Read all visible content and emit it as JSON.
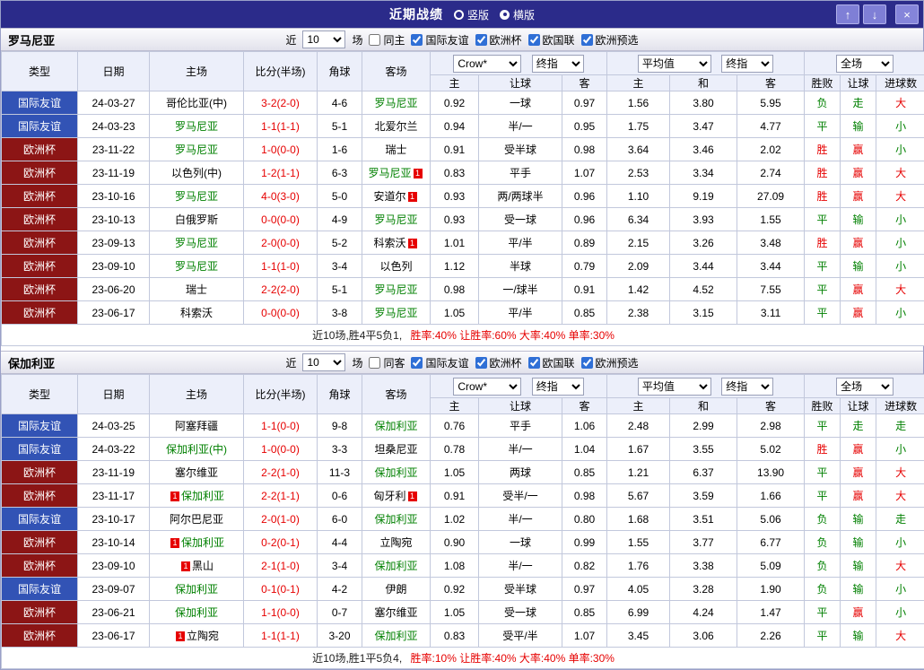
{
  "titlebar": {
    "title": "近期战绩",
    "radios": [
      {
        "label": "竖版",
        "selected": false
      },
      {
        "label": "横版",
        "selected": true
      }
    ],
    "buttons": {
      "up": "↑",
      "down": "↓",
      "close": "×"
    }
  },
  "columns": {
    "type": "类型",
    "date": "日期",
    "home": "主场",
    "score": "比分(半场)",
    "corner": "角球",
    "away": "客场",
    "ah": [
      "主",
      "让球",
      "客"
    ],
    "eu": [
      "主",
      "和",
      "客"
    ],
    "res": [
      "胜败",
      "让球",
      "进球数"
    ]
  },
  "selects": {
    "ah_source": "Crow*",
    "ah_time": "终指",
    "eu_source": "平均值",
    "eu_time": "终指",
    "scope": "全场"
  },
  "league_colors": {
    "国际友谊": "#3253b5",
    "欧洲杯": "#8c1515"
  },
  "result_color_map": {
    "胜": "red",
    "平": "green",
    "负": "green",
    "赢": "red",
    "输": "green",
    "走": "green",
    "大": "red",
    "小": "green"
  },
  "sections": [
    {
      "team": "罗马尼亚",
      "filters": {
        "prefix": "近",
        "count": "10",
        "suffix": "场",
        "venue_label": "同主",
        "venue_checked": false,
        "leagues": [
          {
            "label": "国际友谊",
            "checked": true
          },
          {
            "label": "欧洲杯",
            "checked": true
          },
          {
            "label": "欧国联",
            "checked": true
          },
          {
            "label": "欧洲预选",
            "checked": true
          }
        ]
      },
      "rows": [
        {
          "league": "国际友谊",
          "date": "24-03-27",
          "home": {
            "name": "哥伦比亚(中)",
            "focal": false
          },
          "score": "3-2(2-0)",
          "corner": "4-6",
          "away": {
            "name": "罗马尼亚",
            "focal": true
          },
          "ah": [
            "0.92",
            "一球",
            "0.97"
          ],
          "eu": [
            "1.56",
            "3.80",
            "5.95"
          ],
          "results": [
            "负",
            "走",
            "大"
          ]
        },
        {
          "league": "国际友谊",
          "date": "24-03-23",
          "home": {
            "name": "罗马尼亚",
            "focal": true
          },
          "score": "1-1(1-1)",
          "corner": "5-1",
          "away": {
            "name": "北爱尔兰",
            "focal": false
          },
          "ah": [
            "0.94",
            "半/一",
            "0.95"
          ],
          "eu": [
            "1.75",
            "3.47",
            "4.77"
          ],
          "results": [
            "平",
            "输",
            "小"
          ]
        },
        {
          "league": "欧洲杯",
          "date": "23-11-22",
          "home": {
            "name": "罗马尼亚",
            "focal": true
          },
          "score": "1-0(0-0)",
          "corner": "1-6",
          "away": {
            "name": "瑞士",
            "focal": false
          },
          "ah": [
            "0.91",
            "受半球",
            "0.98"
          ],
          "eu": [
            "3.64",
            "3.46",
            "2.02"
          ],
          "results": [
            "胜",
            "赢",
            "小"
          ]
        },
        {
          "league": "欧洲杯",
          "date": "23-11-19",
          "home": {
            "name": "以色列(中)",
            "focal": false
          },
          "score": "1-2(1-1)",
          "corner": "6-3",
          "away": {
            "name": "罗马尼亚",
            "focal": true,
            "badge": "1",
            "badge_pos": "after"
          },
          "ah": [
            "0.83",
            "平手",
            "1.07"
          ],
          "eu": [
            "2.53",
            "3.34",
            "2.74"
          ],
          "results": [
            "胜",
            "赢",
            "大"
          ]
        },
        {
          "league": "欧洲杯",
          "date": "23-10-16",
          "home": {
            "name": "罗马尼亚",
            "focal": true
          },
          "score": "4-0(3-0)",
          "corner": "5-0",
          "away": {
            "name": "安道尔",
            "focal": false,
            "badge": "1",
            "badge_pos": "after"
          },
          "ah": [
            "0.93",
            "两/两球半",
            "0.96"
          ],
          "eu": [
            "1.10",
            "9.19",
            "27.09"
          ],
          "results": [
            "胜",
            "赢",
            "大"
          ]
        },
        {
          "league": "欧洲杯",
          "date": "23-10-13",
          "home": {
            "name": "白俄罗斯",
            "focal": false
          },
          "score": "0-0(0-0)",
          "corner": "4-9",
          "away": {
            "name": "罗马尼亚",
            "focal": true
          },
          "ah": [
            "0.93",
            "受一球",
            "0.96"
          ],
          "eu": [
            "6.34",
            "3.93",
            "1.55"
          ],
          "results": [
            "平",
            "输",
            "小"
          ]
        },
        {
          "league": "欧洲杯",
          "date": "23-09-13",
          "home": {
            "name": "罗马尼亚",
            "focal": true
          },
          "score": "2-0(0-0)",
          "corner": "5-2",
          "away": {
            "name": "科索沃",
            "focal": false,
            "badge": "1",
            "badge_pos": "after"
          },
          "ah": [
            "1.01",
            "平/半",
            "0.89"
          ],
          "eu": [
            "2.15",
            "3.26",
            "3.48"
          ],
          "results": [
            "胜",
            "赢",
            "小"
          ]
        },
        {
          "league": "欧洲杯",
          "date": "23-09-10",
          "home": {
            "name": "罗马尼亚",
            "focal": true
          },
          "score": "1-1(1-0)",
          "corner": "3-4",
          "away": {
            "name": "以色列",
            "focal": false
          },
          "ah": [
            "1.12",
            "半球",
            "0.79"
          ],
          "eu": [
            "2.09",
            "3.44",
            "3.44"
          ],
          "results": [
            "平",
            "输",
            "小"
          ]
        },
        {
          "league": "欧洲杯",
          "date": "23-06-20",
          "home": {
            "name": "瑞士",
            "focal": false
          },
          "score": "2-2(2-0)",
          "corner": "5-1",
          "away": {
            "name": "罗马尼亚",
            "focal": true
          },
          "ah": [
            "0.98",
            "一/球半",
            "0.91"
          ],
          "eu": [
            "1.42",
            "4.52",
            "7.55"
          ],
          "results": [
            "平",
            "赢",
            "大"
          ]
        },
        {
          "league": "欧洲杯",
          "date": "23-06-17",
          "home": {
            "name": "科索沃",
            "focal": false
          },
          "score": "0-0(0-0)",
          "corner": "3-8",
          "away": {
            "name": "罗马尼亚",
            "focal": true
          },
          "ah": [
            "1.05",
            "平/半",
            "0.85"
          ],
          "eu": [
            "2.38",
            "3.15",
            "3.11"
          ],
          "results": [
            "平",
            "赢",
            "小"
          ]
        }
      ],
      "summary": {
        "prefix": "近10场,胜4平5负1,",
        "stats": "胜率:40% 让胜率:60% 大率:40% 单率:30%"
      }
    },
    {
      "team": "保加利亚",
      "filters": {
        "prefix": "近",
        "count": "10",
        "suffix": "场",
        "venue_label": "同客",
        "venue_checked": false,
        "leagues": [
          {
            "label": "国际友谊",
            "checked": true
          },
          {
            "label": "欧洲杯",
            "checked": true
          },
          {
            "label": "欧国联",
            "checked": true
          },
          {
            "label": "欧洲预选",
            "checked": true
          }
        ]
      },
      "rows": [
        {
          "league": "国际友谊",
          "date": "24-03-25",
          "home": {
            "name": "阿塞拜疆",
            "focal": false
          },
          "score": "1-1(0-0)",
          "corner": "9-8",
          "away": {
            "name": "保加利亚",
            "focal": true
          },
          "ah": [
            "0.76",
            "平手",
            "1.06"
          ],
          "eu": [
            "2.48",
            "2.99",
            "2.98"
          ],
          "results": [
            "平",
            "走",
            "走"
          ]
        },
        {
          "league": "国际友谊",
          "date": "24-03-22",
          "home": {
            "name": "保加利亚(中)",
            "focal": true
          },
          "score": "1-0(0-0)",
          "corner": "3-3",
          "away": {
            "name": "坦桑尼亚",
            "focal": false
          },
          "ah": [
            "0.78",
            "半/一",
            "1.04"
          ],
          "eu": [
            "1.67",
            "3.55",
            "5.02"
          ],
          "results": [
            "胜",
            "赢",
            "小"
          ]
        },
        {
          "league": "欧洲杯",
          "date": "23-11-19",
          "home": {
            "name": "塞尔维亚",
            "focal": false
          },
          "score": "2-2(1-0)",
          "corner": "11-3",
          "away": {
            "name": "保加利亚",
            "focal": true
          },
          "ah": [
            "1.05",
            "两球",
            "0.85"
          ],
          "eu": [
            "1.21",
            "6.37",
            "13.90"
          ],
          "results": [
            "平",
            "赢",
            "大"
          ]
        },
        {
          "league": "欧洲杯",
          "date": "23-11-17",
          "home": {
            "name": "保加利亚",
            "focal": true,
            "badge": "1",
            "badge_pos": "before"
          },
          "score": "2-2(1-1)",
          "corner": "0-6",
          "away": {
            "name": "匈牙利",
            "focal": false,
            "badge": "1",
            "badge_pos": "after"
          },
          "ah": [
            "0.91",
            "受半/一",
            "0.98"
          ],
          "eu": [
            "5.67",
            "3.59",
            "1.66"
          ],
          "results": [
            "平",
            "赢",
            "大"
          ]
        },
        {
          "league": "国际友谊",
          "date": "23-10-17",
          "home": {
            "name": "阿尔巴尼亚",
            "focal": false
          },
          "score": "2-0(1-0)",
          "corner": "6-0",
          "away": {
            "name": "保加利亚",
            "focal": true
          },
          "ah": [
            "1.02",
            "半/一",
            "0.80"
          ],
          "eu": [
            "1.68",
            "3.51",
            "5.06"
          ],
          "results": [
            "负",
            "输",
            "走"
          ]
        },
        {
          "league": "欧洲杯",
          "date": "23-10-14",
          "home": {
            "name": "保加利亚",
            "focal": true,
            "badge": "1",
            "badge_pos": "before"
          },
          "score": "0-2(0-1)",
          "corner": "4-4",
          "away": {
            "name": "立陶宛",
            "focal": false
          },
          "ah": [
            "0.90",
            "一球",
            "0.99"
          ],
          "eu": [
            "1.55",
            "3.77",
            "6.77"
          ],
          "results": [
            "负",
            "输",
            "小"
          ]
        },
        {
          "league": "欧洲杯",
          "date": "23-09-10",
          "home": {
            "name": "黑山",
            "focal": false,
            "badge": "1",
            "badge_pos": "before"
          },
          "score": "2-1(1-0)",
          "corner": "3-4",
          "away": {
            "name": "保加利亚",
            "focal": true
          },
          "ah": [
            "1.08",
            "半/一",
            "0.82"
          ],
          "eu": [
            "1.76",
            "3.38",
            "5.09"
          ],
          "results": [
            "负",
            "输",
            "大"
          ]
        },
        {
          "league": "国际友谊",
          "date": "23-09-07",
          "home": {
            "name": "保加利亚",
            "focal": true
          },
          "score": "0-1(0-1)",
          "corner": "4-2",
          "away": {
            "name": "伊朗",
            "focal": false
          },
          "ah": [
            "0.92",
            "受半球",
            "0.97"
          ],
          "eu": [
            "4.05",
            "3.28",
            "1.90"
          ],
          "results": [
            "负",
            "输",
            "小"
          ]
        },
        {
          "league": "欧洲杯",
          "date": "23-06-21",
          "home": {
            "name": "保加利亚",
            "focal": true
          },
          "score": "1-1(0-0)",
          "corner": "0-7",
          "away": {
            "name": "塞尔维亚",
            "focal": false
          },
          "ah": [
            "1.05",
            "受一球",
            "0.85"
          ],
          "eu": [
            "6.99",
            "4.24",
            "1.47"
          ],
          "results": [
            "平",
            "赢",
            "小"
          ]
        },
        {
          "league": "欧洲杯",
          "date": "23-06-17",
          "home": {
            "name": "立陶宛",
            "focal": false,
            "badge": "1",
            "badge_pos": "before"
          },
          "score": "1-1(1-1)",
          "corner": "3-20",
          "away": {
            "name": "保加利亚",
            "focal": true
          },
          "ah": [
            "0.83",
            "受平/半",
            "1.07"
          ],
          "eu": [
            "3.45",
            "3.06",
            "2.26"
          ],
          "results": [
            "平",
            "输",
            "大"
          ]
        }
      ],
      "summary": {
        "prefix": "近10场,胜1平5负4,",
        "stats": "胜率:10% 让胜率:40% 大率:40% 单率:30%"
      }
    }
  ]
}
